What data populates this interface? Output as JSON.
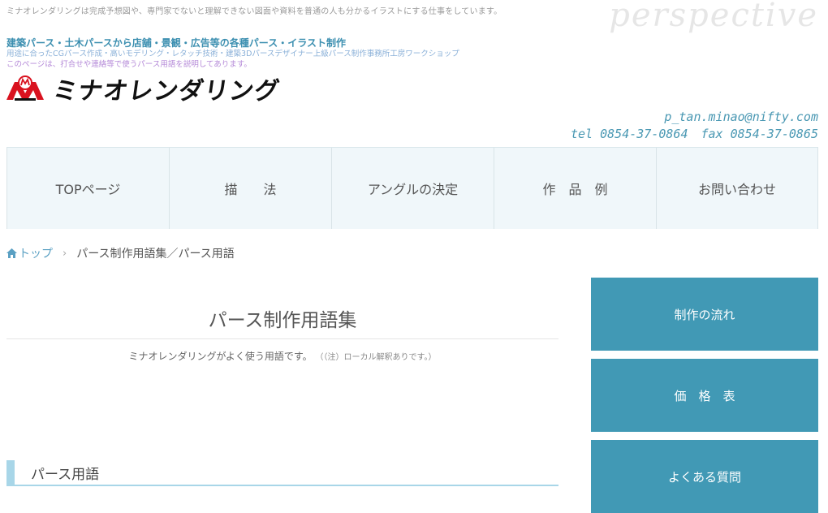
{
  "header": {
    "top_note": "ミナオレンダリングは完成予想図や、専門家でないと理解できない図面や資料を普通の人も分かるイラストにする仕事をしています。",
    "watermark": "perspective",
    "tagline": "建築パース・土木パースから店舗・景観・広告等の各種パース・イラスト制作",
    "subline1": "用途に合ったCGパース作成・高いモデリング・レタッチ技術・建築3Dパースデザイナー上級パース制作事務所工房ワークショップ",
    "subline2": "このページは、打合せや連絡等で使うパース用語を説明してあります。",
    "logo_text": "ミナオレンダリング",
    "email": "p_tan.minao@nifty.com",
    "tel": "tel 0854-37-0864",
    "fax": "fax 0854-37-0865",
    "colors": {
      "accent": "#4199b5",
      "nav_bg": "#f0f7fa",
      "logo_red": "#d9121f"
    }
  },
  "nav": {
    "items": [
      {
        "label": "TOPページ"
      },
      {
        "label": "描　　法"
      },
      {
        "label": "アングルの決定"
      },
      {
        "label": "作　品　例"
      },
      {
        "label": "お問い合わせ"
      }
    ]
  },
  "breadcrumb": {
    "home_icon": "home-icon",
    "home": "トップ",
    "separator": "›",
    "current": "パース制作用語集／パース用語"
  },
  "main": {
    "title": "パース制作用語集",
    "intro": "ミナオレンダリングがよく使う用語です。",
    "intro_note": "（（注）ローカル解釈ありです。）",
    "section_heading": "パース用語"
  },
  "sidebar": {
    "buttons": [
      {
        "label": "制作の流れ"
      },
      {
        "label": "価　格　表"
      },
      {
        "label": "よくある質問"
      }
    ]
  }
}
